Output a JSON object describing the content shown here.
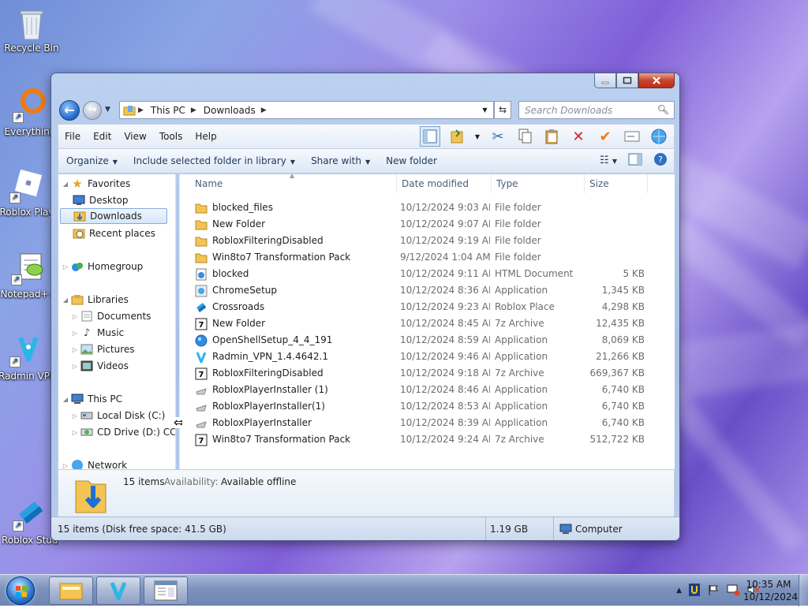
{
  "desktop": {
    "icons": [
      {
        "label": "Recycle Bin",
        "icon": "recycle-bin-icon"
      },
      {
        "label": "Everything",
        "icon": "everything-icon"
      },
      {
        "label": "Roblox Play",
        "icon": "roblox-player-icon"
      },
      {
        "label": "Notepad++",
        "icon": "notepad-plus-plus-icon"
      },
      {
        "label": "Radmin VPN",
        "icon": "radmin-vpn-icon"
      },
      {
        "label": "Roblox Studio",
        "icon": "roblox-studio-icon"
      }
    ]
  },
  "window": {
    "address": {
      "segments": [
        "This PC",
        "Downloads"
      ]
    },
    "search_placeholder": "Search Downloads",
    "menu": [
      "File",
      "Edit",
      "View",
      "Tools",
      "Help"
    ],
    "commands": {
      "organize": "Organize",
      "include": "Include selected folder in library",
      "share": "Share with",
      "new_folder": "New folder"
    },
    "nav": {
      "favorites": "Favorites",
      "desktop": "Desktop",
      "downloads": "Downloads",
      "recent": "Recent places",
      "homegroup": "Homegroup",
      "libraries": "Libraries",
      "documents": "Documents",
      "music": "Music",
      "pictures": "Pictures",
      "videos": "Videos",
      "thispc": "This PC",
      "localdisk": "Local Disk (C:)",
      "cddrive": "CD Drive (D:) CC",
      "network": "Network"
    },
    "columns": {
      "name": "Name",
      "date": "Date modified",
      "type": "Type",
      "size": "Size"
    },
    "files": [
      {
        "name": "blocked_files",
        "date": "10/12/2024 9:03 AM",
        "type": "File folder",
        "size": "",
        "icon": "folder-icon"
      },
      {
        "name": "New Folder",
        "date": "10/12/2024 9:07 AM",
        "type": "File folder",
        "size": "",
        "icon": "folder-icon"
      },
      {
        "name": "RobloxFilteringDisabled",
        "date": "10/12/2024 9:19 AM",
        "type": "File folder",
        "size": "",
        "icon": "folder-icon"
      },
      {
        "name": "Win8to7 Transformation Pack",
        "date": "9/12/2024 1:04 AM",
        "type": "File folder",
        "size": "",
        "icon": "folder-icon"
      },
      {
        "name": "blocked",
        "date": "10/12/2024 9:11 AM",
        "type": "HTML Document",
        "size": "5 KB",
        "icon": "html-document-icon"
      },
      {
        "name": "ChromeSetup",
        "date": "10/12/2024 8:36 AM",
        "type": "Application",
        "size": "1,345 KB",
        "icon": "chrome-setup-icon"
      },
      {
        "name": "Crossroads",
        "date": "10/12/2024 9:23 AM",
        "type": "Roblox Place",
        "size": "4,298 KB",
        "icon": "roblox-place-icon"
      },
      {
        "name": "New Folder",
        "date": "10/12/2024 8:45 AM",
        "type": "7z Archive",
        "size": "12,435 KB",
        "icon": "archive-icon"
      },
      {
        "name": "OpenShellSetup_4_4_191",
        "date": "10/12/2024 8:59 AM",
        "type": "Application",
        "size": "8,069 KB",
        "icon": "openshell-icon"
      },
      {
        "name": "Radmin_VPN_1.4.4642.1",
        "date": "10/12/2024 9:46 AM",
        "type": "Application",
        "size": "21,266 KB",
        "icon": "radmin-vpn-icon"
      },
      {
        "name": "RobloxFilteringDisabled",
        "date": "10/12/2024 9:18 AM",
        "type": "7z Archive",
        "size": "669,367 KB",
        "icon": "archive-icon"
      },
      {
        "name": "RobloxPlayerInstaller (1)",
        "date": "10/12/2024 8:46 AM",
        "type": "Application",
        "size": "6,740 KB",
        "icon": "roblox-installer-icon"
      },
      {
        "name": "RobloxPlayerInstaller(1)",
        "date": "10/12/2024 8:53 AM",
        "type": "Application",
        "size": "6,740 KB",
        "icon": "roblox-installer-icon"
      },
      {
        "name": "RobloxPlayerInstaller",
        "date": "10/12/2024 8:39 AM",
        "type": "Application",
        "size": "6,740 KB",
        "icon": "roblox-installer-icon"
      },
      {
        "name": "Win8to7 Transformation Pack",
        "date": "10/12/2024 9:24 AM",
        "type": "7z Archive",
        "size": "512,722 KB",
        "icon": "archive-icon"
      }
    ],
    "details": {
      "count": "15 items",
      "availability_label": "Availability:",
      "availability_value": "Available offline"
    },
    "status": {
      "left": "15 items (Disk free space: 41.5 GB)",
      "size": "1.19 GB",
      "location": "Computer"
    }
  },
  "taskbar": {
    "clock_time": "10:35 AM",
    "clock_date": "10/12/2024"
  },
  "colors": {
    "selection": "#d5e7fb",
    "accent": "#1d64c8",
    "folder": "#f3c454",
    "close": "#c8452c"
  }
}
